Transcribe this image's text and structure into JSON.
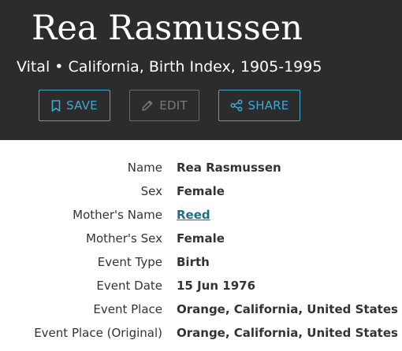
{
  "header": {
    "title": "Rea Rasmussen",
    "subtitle": "Vital • California, Birth Index, 1905-1995"
  },
  "actions": {
    "save_label": "SAVE",
    "edit_label": "EDIT",
    "share_label": "SHARE"
  },
  "details": [
    {
      "label": "Name",
      "value": "Rea Rasmussen"
    },
    {
      "label": "Sex",
      "value": "Female"
    },
    {
      "label": "Mother's Name",
      "value": "Reed"
    },
    {
      "label": "Mother's Sex",
      "value": "Female"
    },
    {
      "label": "Event Type",
      "value": "Birth"
    },
    {
      "label": "Event Date",
      "value": "15 Jun 1976"
    },
    {
      "label": "Event Place",
      "value": "Orange, California, United States"
    },
    {
      "label": "Event Place (Original)",
      "value": "Orange, California, United States"
    }
  ],
  "colors": {
    "header_bg": "#2c2c2c",
    "accent": "#3ea9d2",
    "link": "#1a6f86",
    "disabled": "#7a7a7a"
  }
}
